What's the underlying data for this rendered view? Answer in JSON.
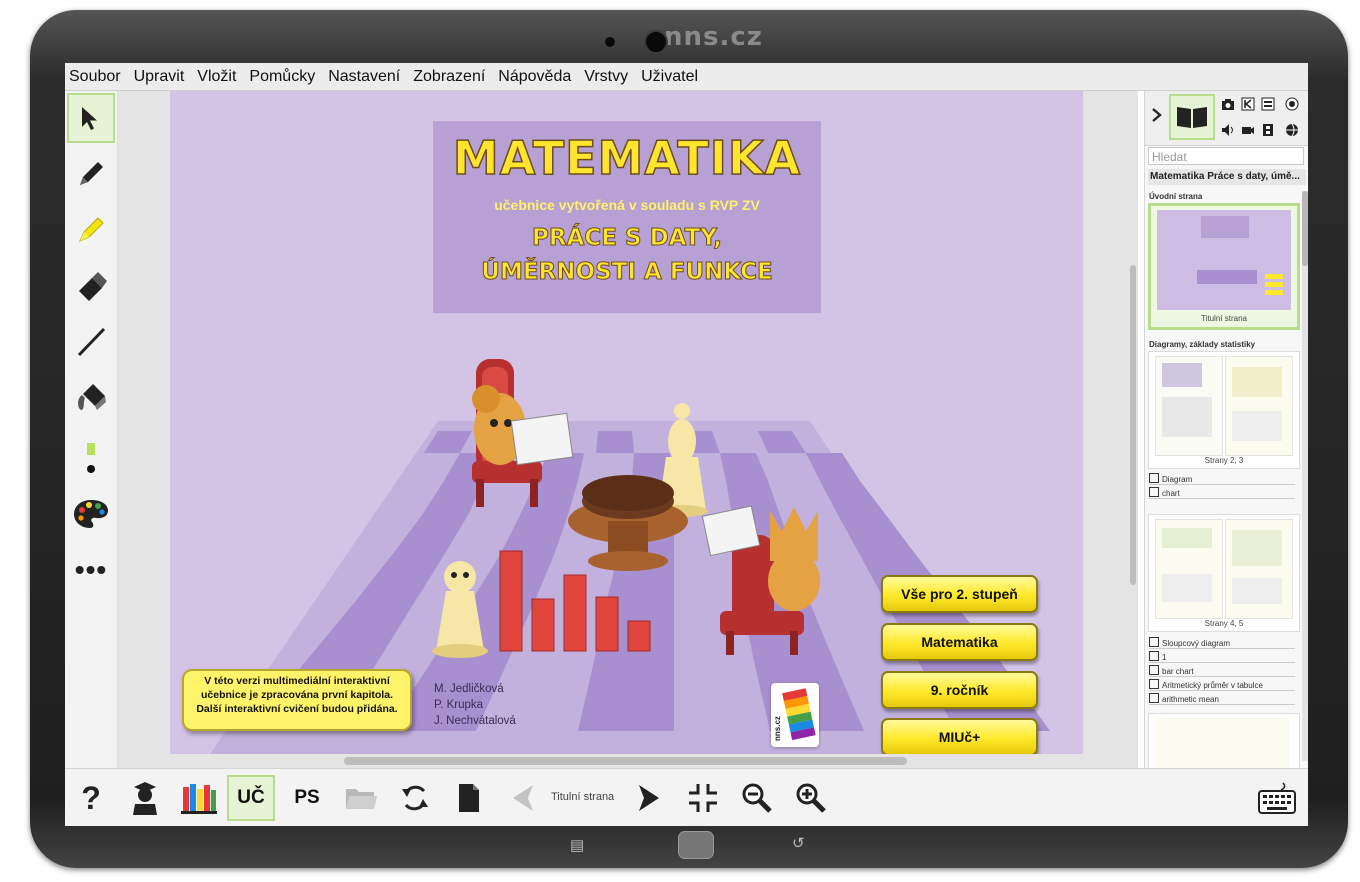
{
  "device": {
    "brand": "nns.cz"
  },
  "menu": [
    "Soubor",
    "Upravit",
    "Vložit",
    "Pomůcky",
    "Nastavení",
    "Zobrazení",
    "Nápověda",
    "Vrstvy",
    "Uživatel"
  ],
  "cover": {
    "title": "MATEMATIKA",
    "subtitle": "učebnice vytvořená v souladu s RVP ZV",
    "heading_line1": "PRÁCE S DATY,",
    "heading_line2": "ÚMĚRNOSTI A FUNKCE",
    "note_lines": [
      "V této verzi multimediální interaktivní",
      "učebnice je zpracována první kapitola.",
      "Další interaktivní cvičení budou přidána."
    ],
    "authors": [
      "M. Jedličková",
      "P. Krupka",
      "J. Nechvátalová"
    ],
    "buttons": [
      "Vše pro 2. stupeň",
      "Matematika",
      "9. ročník",
      "MIUč+"
    ],
    "logo_text": "nns.cz"
  },
  "panel": {
    "search_placeholder": "Hledat",
    "book_title": "Matematika Práce s daty, úmě...",
    "sections": [
      {
        "title": "Úvodní strana",
        "pages": "Titulní strana"
      },
      {
        "title": "Diagramy, základy statistiky",
        "pages": "Strany 2, 3",
        "items": [
          "Diagram",
          "chart"
        ]
      },
      {
        "pages": "Strany 4, 5",
        "items": [
          "Sloupcový diagram",
          "1",
          "bar chart",
          "Aritmetický průměr v tabulce",
          "arithmetic mean"
        ]
      }
    ]
  },
  "bottom": {
    "uc": "UČ",
    "ps": "PS",
    "page_label": "Titulní strana"
  }
}
